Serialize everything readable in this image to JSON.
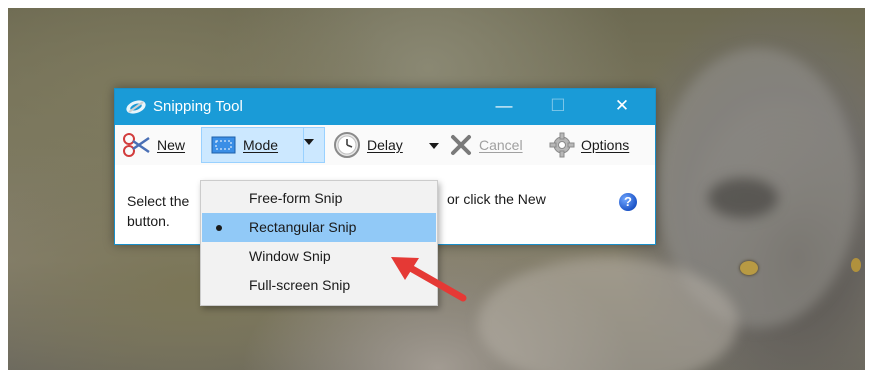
{
  "window": {
    "title": "Snipping Tool",
    "controls": {
      "minimize": "—",
      "maximize": "☐",
      "close": "✕"
    }
  },
  "toolbar": {
    "new_label": "New",
    "mode_label": "Mode",
    "delay_label": "Delay",
    "cancel_label": "Cancel",
    "options_label": "Options"
  },
  "content": {
    "line1_start": "Select the",
    "line1_end": "or click the New",
    "line2": "button."
  },
  "mode_menu": {
    "items": [
      {
        "label": "Free-form Snip",
        "selected": false
      },
      {
        "label": "Rectangular Snip",
        "selected": true
      },
      {
        "label": "Window Snip",
        "selected": false
      },
      {
        "label": "Full-screen Snip",
        "selected": false
      }
    ]
  },
  "icons": {
    "app": "scissors-icon",
    "new": "scissors-icon",
    "mode": "rectangle-snip-icon",
    "delay": "clock-icon",
    "cancel": "x-icon",
    "options": "gear-icon",
    "help": "help-icon"
  },
  "colors": {
    "titlebar": "#1a9bd7",
    "menu_highlight": "#91c9f7",
    "annotation_arrow": "#e53935"
  }
}
